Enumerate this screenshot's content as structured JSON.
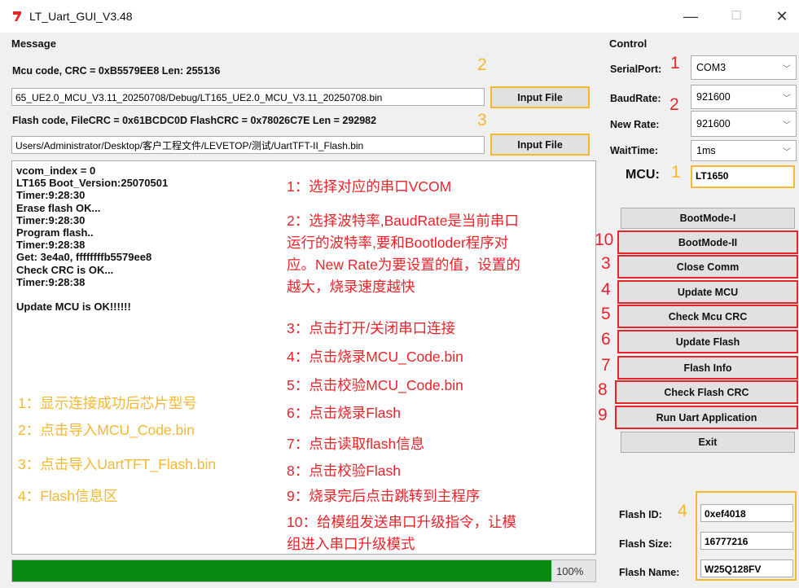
{
  "window": {
    "title": "LT_Uart_GUI_V3.48",
    "minimize": "—",
    "maximize": "☐",
    "close": "✕"
  },
  "message": {
    "section": "Message",
    "mcu_code_line": "Mcu code, CRC = 0xB5579EE8 Len: 255136",
    "mcu_file_path": "65_UE2.0_MCU_V3.11_20250708/Debug/LT165_UE2.0_MCU_V3.11_20250708.bin",
    "input_file_label": "Input File",
    "flash_code_line": "Flash code, FileCRC = 0x61BCDC0D  FlashCRC = 0x78026C7E  Len = 292982",
    "flash_file_path": "Users/Administrator/Desktop/客户工程文件/LEVETOP/测试/UartTFT-II_Flash.bin",
    "input_file2_label": "Input File",
    "log_lines": [
      "vcom_index = 0",
      "LT165 Boot_Version:25070501",
      "Timer:9:28:30",
      "Erase flash OK...",
      "Timer:9:28:30",
      "Program flash..",
      "Timer:9:28:38",
      "Get: 3e4a0, ffffffffb5579ee8",
      "Check CRC is OK...",
      "Timer:9:28:38",
      "",
      "Update MCU is OK!!!!!!"
    ],
    "progress": {
      "value": 100,
      "text": "100%"
    }
  },
  "annotations": {
    "red": [
      "1：选择对应的串口VCOM",
      "2：选择波特率,BaudRate是当前串口",
      "运行的波特率,要和Bootloder程序对",
      "应。New Rate为要设置的值，设置的",
      "越大，烧录速度越快",
      "3：点击打开/关闭串口连接",
      "4：点击烧录MCU_Code.bin",
      "5：点击校验MCU_Code.bin",
      "6：点击烧录Flash",
      "7：点击读取flash信息",
      "8：点击校验Flash",
      "9：烧录完后点击跳转到主程序",
      "10：给模组发送串口升级指令，让模",
      "组进入串口升级模式"
    ],
    "yellow": [
      "1：显示连接成功后芯片型号",
      "2：点击导入MCU_Code.bin",
      "3：点击导入UartTFT_Flash.bin",
      "4：Flash信息区"
    ],
    "markers": {
      "yellow_2": "2",
      "yellow_3": "3",
      "red_1": "1",
      "red_2": "2",
      "yellow_1": "1",
      "red_10": "10",
      "red_3": "3",
      "red_4": "4",
      "red_5": "5",
      "red_6": "6",
      "red_7": "7",
      "red_8": "8",
      "red_9": "9",
      "yellow_4": "4"
    }
  },
  "control": {
    "section": "Control",
    "serial_port_label": "SerialPort:",
    "serial_port_value": "COM3",
    "baud_rate_label": "BaudRate:",
    "baud_rate_value": "921600",
    "new_rate_label": "New Rate:",
    "new_rate_value": "921600",
    "wait_time_label": "WaitTime:",
    "wait_time_value": "1ms",
    "mcu_label": "MCU:",
    "mcu_value": "LT1650",
    "buttons": [
      "BootMode-I",
      "BootMode-II",
      "Close Comm",
      "Update MCU",
      "Check Mcu CRC",
      "Update Flash",
      "Flash Info",
      "Check Flash CRC",
      "Run Uart Application",
      "Exit"
    ],
    "flash_id_label": "Flash ID:",
    "flash_id_value": "0xef4018",
    "flash_size_label": "Flash Size:",
    "flash_size_value": "16777216",
    "flash_name_label": "Flash Name:",
    "flash_name_value": "W25Q128FV"
  },
  "colors": {
    "annotation_red": "#e8232a",
    "annotation_yellow": "#f5b82e",
    "progress_green": "#0a8a14"
  }
}
